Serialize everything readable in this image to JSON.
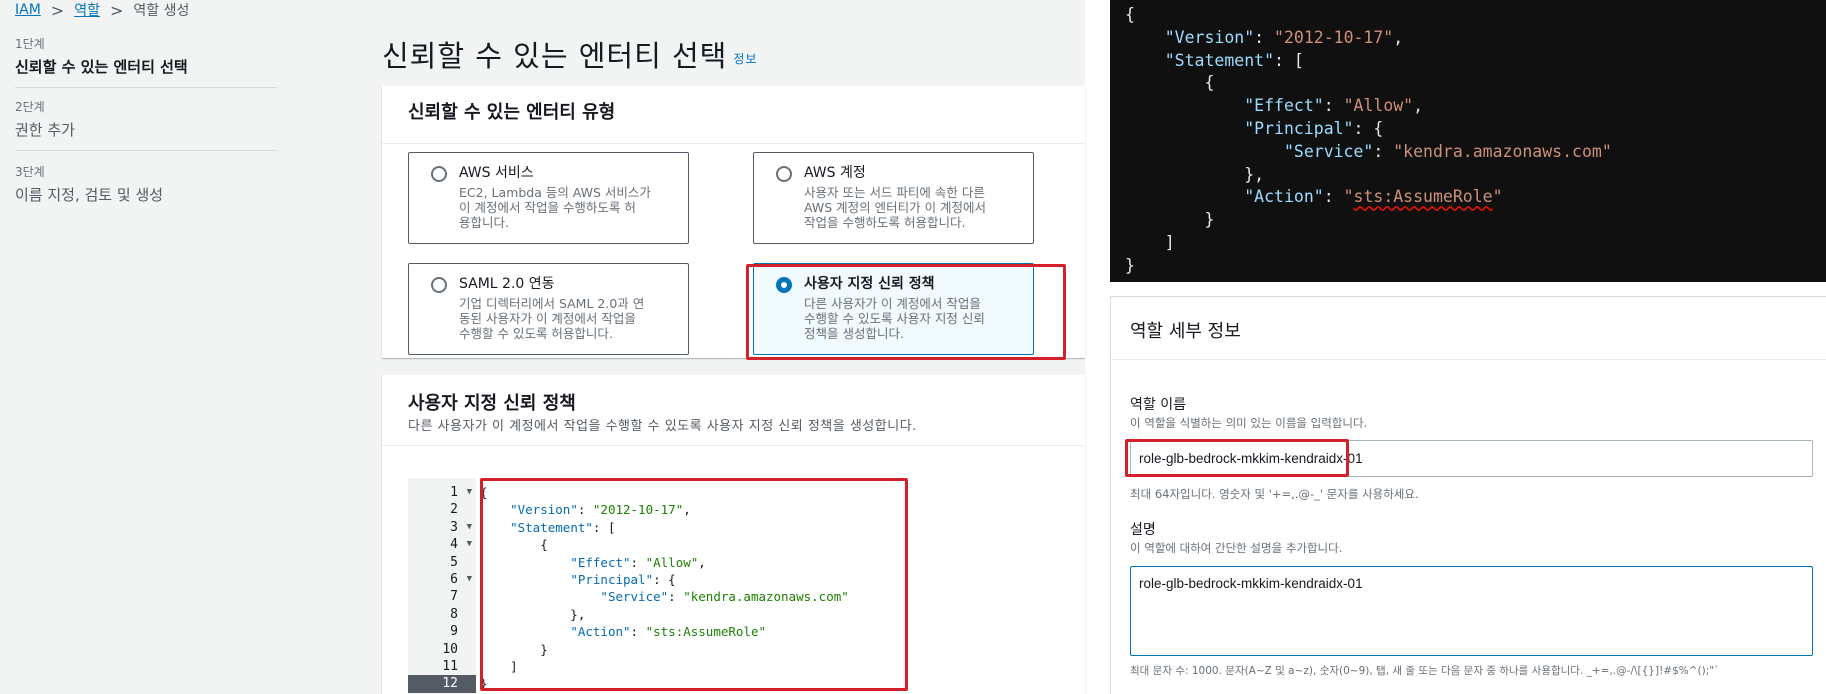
{
  "breadcrumb": {
    "items": [
      "IAM",
      "역할",
      "역할 생성"
    ],
    "sep": ">"
  },
  "steps": [
    {
      "num": "1단계",
      "label": "신뢰할 수 있는 엔터티 선택"
    },
    {
      "num": "2단계",
      "label": "권한 추가"
    },
    {
      "num": "3단계",
      "label": "이름 지정, 검토 및 생성"
    }
  ],
  "page": {
    "title": "신뢰할 수 있는 엔터티 선택",
    "info": "정보"
  },
  "entity_type": {
    "title": "신뢰할 수 있는 엔터티 유형",
    "options": [
      {
        "title": "AWS 서비스",
        "desc": [
          "EC2, Lambda 등의 AWS 서비스가",
          "이 계정에서 작업을 수행하도록 허",
          "용합니다."
        ],
        "selected": false
      },
      {
        "title": "AWS 계정",
        "desc": [
          "사용자 또는 서드 파티에 속한 다른",
          "AWS 계정의 엔터티가 이 계정에서",
          "작업을 수행하도록 허용합니다."
        ],
        "selected": false
      },
      {
        "title": "SAML 2.0 연동",
        "desc": [
          "기업 디렉터리에서 SAML 2.0과 연",
          "동된 사용자가 이 계정에서 작업을",
          "수행할 수 있도록 허용합니다."
        ],
        "selected": false
      },
      {
        "title": "사용자 지정 신뢰 정책",
        "desc": [
          "다른 사용자가 이 계정에서 작업을",
          "수행할 수 있도록 사용자 지정 신뢰",
          "정책을 생성합니다."
        ],
        "selected": true
      }
    ]
  },
  "custom_policy": {
    "title": "사용자 지정 신뢰 정책",
    "subtitle": "다른 사용자가 이 계정에서 작업을 수행할 수 있도록 사용자 지정 신뢰 정책을 생성합니다.",
    "lines": [
      {
        "n": "1",
        "fold": true,
        "text": "{"
      },
      {
        "n": "2",
        "fold": false,
        "text": "    \"Version\": \"2012-10-17\","
      },
      {
        "n": "3",
        "fold": true,
        "text": "    \"Statement\": ["
      },
      {
        "n": "4",
        "fold": true,
        "text": "        {"
      },
      {
        "n": "5",
        "fold": false,
        "text": "            \"Effect\": \"Allow\","
      },
      {
        "n": "6",
        "fold": true,
        "text": "            \"Principal\": {"
      },
      {
        "n": "7",
        "fold": false,
        "text": "                \"Service\": \"kendra.amazonaws.com\""
      },
      {
        "n": "8",
        "fold": false,
        "text": "            },"
      },
      {
        "n": "9",
        "fold": false,
        "text": "            \"Action\": \"sts:AssumeRole\""
      },
      {
        "n": "10",
        "fold": false,
        "text": "        }"
      },
      {
        "n": "11",
        "fold": false,
        "text": "    ]"
      },
      {
        "n": "12",
        "fold": false,
        "text": "}"
      }
    ]
  },
  "json_view": {
    "lines": [
      "{",
      "    \"Version\": \"2012-10-17\",",
      "    \"Statement\": [",
      "        {",
      "            \"Effect\": \"Allow\",",
      "            \"Principal\": {",
      "                \"Service\": \"kendra.amazonaws.com\"",
      "            },",
      "            \"Action\": \"sts:AssumeRole\"",
      "        }",
      "    ]",
      "}"
    ]
  },
  "role_details": {
    "title": "역할 세부 정보",
    "name_label": "역할 이름",
    "name_desc": "이 역할을 식별하는 의미 있는 이름을 입력합니다.",
    "name_value": "role-glb-bedrock-mkkim-kendraidx-01",
    "name_hint": "최대 64자입니다. 영숫자 및 '+=,.@-_' 문자를 사용하세요.",
    "desc_label": "설명",
    "desc_desc": "이 역할에 대하여 간단한 설명을 추가합니다.",
    "desc_value": "role-glb-bedrock-mkkim-kendraidx-01",
    "desc_hint": "최대 문자 수: 1000. 문자(A~Z 및 a~z), 숫자(0~9), 탭, 새 줄 또는 다음 문자 중 하나를 사용합니다. _+=,.@-/\\[{}]!#$%^();\"`"
  },
  "colors": {
    "highlight": "#d4202a",
    "link": "#0073bb",
    "selected_bg": "#f1faff"
  }
}
